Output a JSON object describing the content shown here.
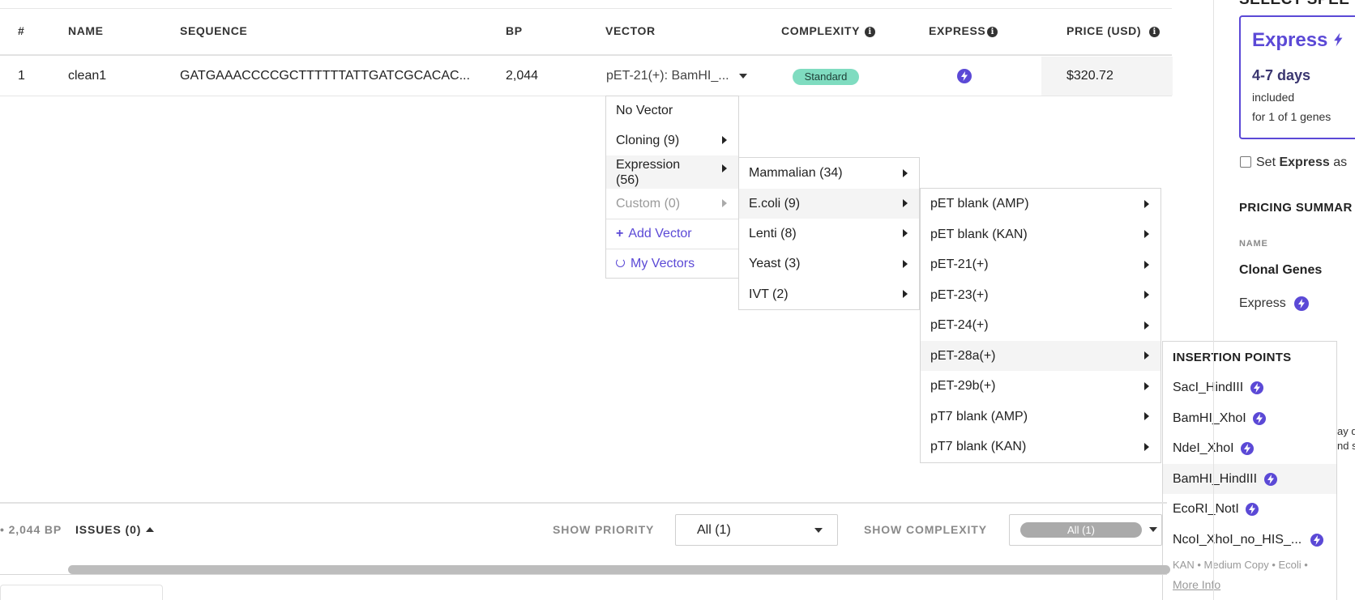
{
  "colors": {
    "accent": "#5b49d6",
    "badge_bg": "#7fdcc0",
    "link": "#5b49d6"
  },
  "table": {
    "headers": {
      "num": "#",
      "name": "NAME",
      "sequence": "SEQUENCE",
      "bp": "BP",
      "vector": "VECTOR",
      "complexity": "COMPLEXITY",
      "express": "EXPRESS",
      "price": "PRICE (USD)"
    },
    "row": {
      "num": "1",
      "name": "clean1",
      "sequence": "GATGAAACCCCGCTTTTTTATTGATCGCACAC...",
      "bp": "2,044",
      "vector": "pET-21(+): BamHI_...",
      "complexity": "Standard",
      "price": "$320.72"
    }
  },
  "menu_vector": {
    "items": {
      "no_vector": "No Vector",
      "cloning": "Cloning (9)",
      "expression_l1": "Expression",
      "expression_l2": "(56)",
      "custom": "Custom (0)",
      "add_vector": "Add Vector",
      "my_vectors": "My Vectors"
    }
  },
  "menu_expression": {
    "items": [
      "Mammalian (34)",
      "E.coli (9)",
      "Lenti (8)",
      "Yeast (3)",
      "IVT (2)"
    ]
  },
  "menu_ecoli": {
    "items": [
      "pET blank (AMP)",
      "pET blank (KAN)",
      "pET-21(+)",
      "pET-23(+)",
      "pET-24(+)",
      "pET-28a(+)",
      "pET-29b(+)",
      "pT7 blank (AMP)",
      "pT7 blank (KAN)"
    ]
  },
  "menu_insertion": {
    "title": "INSERTION POINTS",
    "items": [
      "SacI_HindIII",
      "BamHI_XhoI",
      "NdeI_XhoI",
      "BamHI_HindIII",
      "EcoRI_NotI",
      "NcoI_XhoI_no_HIS_..."
    ],
    "footer": "KAN • Medium Copy • Ecoli •",
    "more_info": "More Info"
  },
  "right_panel": {
    "clipped_heading": "SELECT SPEE",
    "express_title": "Express",
    "express_days": "4-7 days",
    "included": "included",
    "for_genes": "for 1 of 1 genes",
    "set_express_prefix": "Set",
    "set_express_bold": "Express",
    "set_express_suffix": "as",
    "pricing_summary": "PRICING SUMMAR",
    "name_label": "NAME",
    "clonal_genes": "Clonal Genes",
    "express_line": "Express",
    "clipped_text_1": "ay d",
    "clipped_text_2": "nd s"
  },
  "bottom_bar": {
    "bp_total": "• 2,044 BP",
    "issues": "ISSUES (0)",
    "show_priority": "SHOW PRIORITY",
    "priority_value": "All (1)",
    "show_complexity": "SHOW COMPLEXITY",
    "complexity_value": "All (1)"
  }
}
